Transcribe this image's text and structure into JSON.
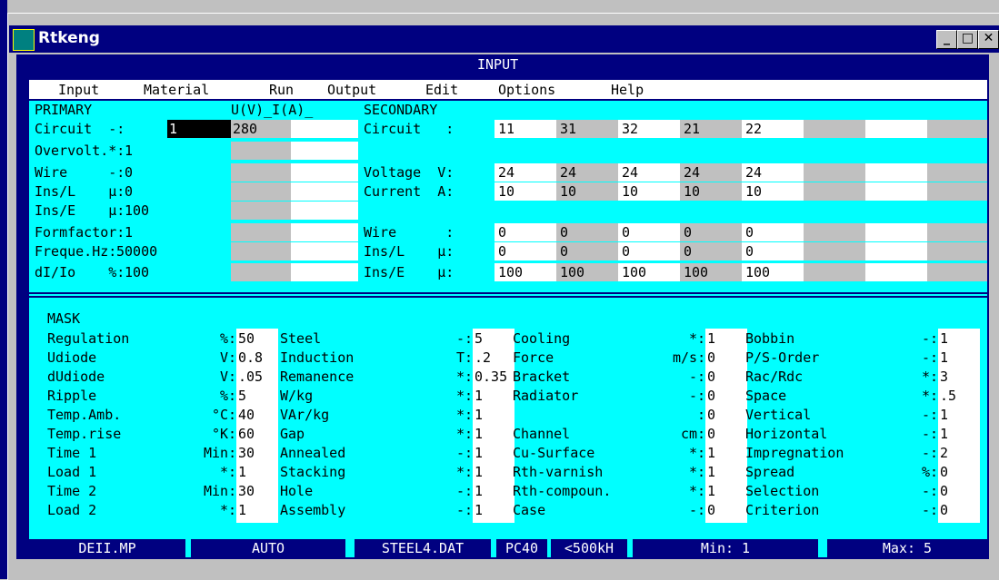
{
  "window": {
    "title": "Rtkeng",
    "min": "_",
    "max": "□",
    "close": "✕"
  },
  "screen_title": "INPUT",
  "menu": [
    "Input",
    "Material",
    "Run",
    "Output",
    "Edit",
    "Options",
    "Help"
  ],
  "primary": {
    "header": "PRIMARY",
    "uv_header": "U(V)_I(A)_",
    "rows": [
      {
        "label": "Circuit",
        "unit": "-",
        "value": "1",
        "uv": "280"
      },
      {
        "label": "Overvolt.",
        "unit": "*",
        "value": "1"
      },
      {
        "label": "Wire",
        "unit": "-",
        "value": "0"
      },
      {
        "label": "Ins/L",
        "unit": "µ",
        "value": "0"
      },
      {
        "label": "Ins/E",
        "unit": "µ",
        "value": "100"
      },
      {
        "label": "Formfactor",
        "unit": "",
        "value": "1"
      },
      {
        "label": "Freque.Hz",
        "unit": "",
        "value": "50000"
      },
      {
        "label": "dI/Io",
        "unit": "%",
        "value": "100"
      }
    ]
  },
  "secondary": {
    "header": "SECONDARY",
    "rows": [
      {
        "label": "Circuit",
        "unit": "",
        "values": [
          "11",
          "31",
          "32",
          "21",
          "22"
        ]
      },
      {
        "label": "Voltage",
        "unit": "V",
        "values": [
          "24",
          "24",
          "24",
          "24",
          "24"
        ]
      },
      {
        "label": "Current",
        "unit": "A",
        "values": [
          "10",
          "10",
          "10",
          "10",
          "10"
        ]
      },
      {
        "label": "Wire",
        "unit": "",
        "values": [
          "0",
          "0",
          "0",
          "0",
          "0"
        ]
      },
      {
        "label": "Ins/L",
        "unit": "µ",
        "values": [
          "0",
          "0",
          "0",
          "0",
          "0"
        ]
      },
      {
        "label": "Ins/E",
        "unit": "µ",
        "values": [
          "100",
          "100",
          "100",
          "100",
          "100"
        ]
      }
    ]
  },
  "mask": {
    "title": "MASK",
    "columns": [
      [
        {
          "label": "Regulation",
          "unit": "%",
          "value": "50"
        },
        {
          "label": "Udiode",
          "unit": "V",
          "value": "0.8"
        },
        {
          "label": "dUdiode",
          "unit": "V",
          "value": ".05"
        },
        {
          "label": "Ripple",
          "unit": "%",
          "value": "5"
        },
        {
          "label": "Temp.Amb.",
          "unit": "°C",
          "value": "40"
        },
        {
          "label": "Temp.rise",
          "unit": "°K",
          "value": "60"
        },
        {
          "label": "Time 1",
          "unit": "Min",
          "value": "30"
        },
        {
          "label": "Load 1",
          "unit": "*",
          "value": "1"
        },
        {
          "label": "Time 2",
          "unit": "Min",
          "value": "30"
        },
        {
          "label": "Load 2",
          "unit": "*",
          "value": "1"
        }
      ],
      [
        {
          "label": "Steel",
          "unit": "-",
          "value": "5"
        },
        {
          "label": "Induction",
          "unit": "T",
          "value": ".2"
        },
        {
          "label": "Remanence",
          "unit": "*",
          "value": "0.35"
        },
        {
          "label": "W/kg",
          "unit": "*",
          "value": "1"
        },
        {
          "label": "VAr/kg",
          "unit": "*",
          "value": "1"
        },
        {
          "label": "Gap",
          "unit": "*",
          "value": "1"
        },
        {
          "label": "Annealed",
          "unit": "-",
          "value": "1"
        },
        {
          "label": "Stacking",
          "unit": "*",
          "value": "1"
        },
        {
          "label": "Hole",
          "unit": "-",
          "value": "1"
        },
        {
          "label": "Assembly",
          "unit": "-",
          "value": "1"
        }
      ],
      [
        {
          "label": "Cooling",
          "unit": "*",
          "value": "1"
        },
        {
          "label": "Force",
          "unit": "m/s",
          "value": "0"
        },
        {
          "label": "Bracket",
          "unit": "-",
          "value": "0"
        },
        {
          "label": "Radiator",
          "unit": "-",
          "value": "0"
        },
        {
          "label": "",
          "unit": "",
          "value": "0"
        },
        {
          "label": "Channel",
          "unit": "cm",
          "value": "0"
        },
        {
          "label": "Cu-Surface",
          "unit": "*",
          "value": "1"
        },
        {
          "label": "Rth-varnish",
          "unit": "*",
          "value": "1"
        },
        {
          "label": "Rth-compoun.",
          "unit": "*",
          "value": "1"
        },
        {
          "label": "Case",
          "unit": "-",
          "value": "0"
        }
      ],
      [
        {
          "label": "Bobbin",
          "unit": "-",
          "value": "1"
        },
        {
          "label": "P/S-Order",
          "unit": "-",
          "value": "1"
        },
        {
          "label": "Rac/Rdc",
          "unit": "*",
          "value": "3"
        },
        {
          "label": "Space",
          "unit": "*",
          "value": ".5"
        },
        {
          "label": "Vertical",
          "unit": "-",
          "value": "1"
        },
        {
          "label": "Horizontal",
          "unit": "-",
          "value": "1"
        },
        {
          "label": "Impregnation",
          "unit": "-",
          "value": "2"
        },
        {
          "label": "Spread",
          "unit": "%",
          "value": "0"
        },
        {
          "label": "Selection",
          "unit": "-",
          "value": "0"
        },
        {
          "label": "Criterion",
          "unit": "-",
          "value": "0"
        }
      ]
    ]
  },
  "status": [
    "DEII.MP",
    "AUTO",
    "STEEL4.DAT",
    "PC40",
    "<500kH",
    "Min: 1",
    "Max: 5"
  ],
  "colors": {
    "title_bar": "#000080",
    "panel": "#00ffff",
    "field": "#ffffff",
    "shade": "#c0c0c0",
    "status": "#000080"
  }
}
